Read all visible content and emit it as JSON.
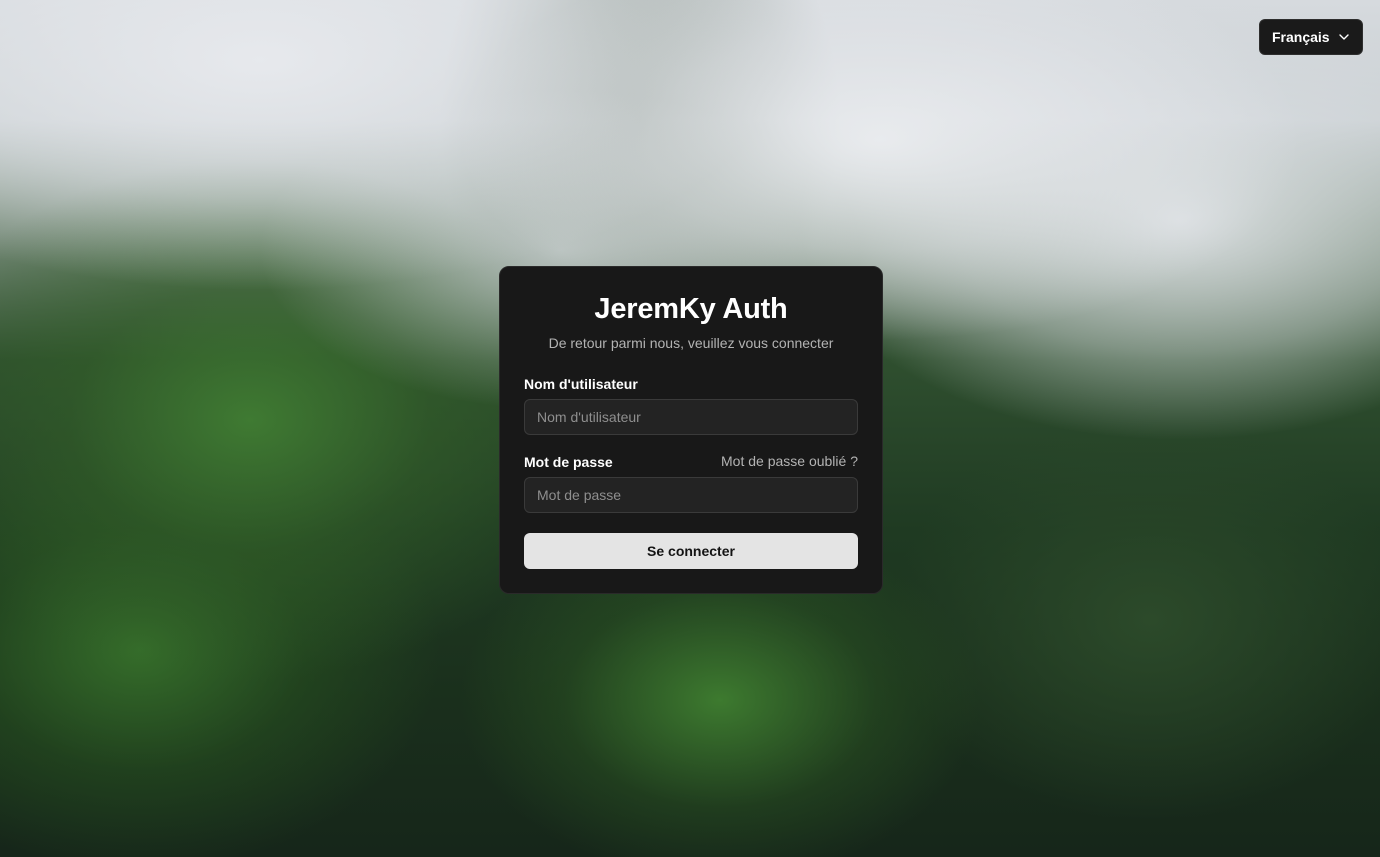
{
  "language_selector": {
    "selected": "Français",
    "icon": "chevron-down-icon"
  },
  "login_card": {
    "title": "JeremKy Auth",
    "subtitle": "De retour parmi nous, veuillez vous connecter",
    "username": {
      "label": "Nom d'utilisateur",
      "placeholder": "Nom d'utilisateur",
      "value": ""
    },
    "password": {
      "label": "Mot de passe",
      "placeholder": "Mot de passe",
      "value": "",
      "forgot_link": "Mot de passe oublié ?"
    },
    "submit_label": "Se connecter"
  },
  "colors": {
    "card_background": "#181818",
    "input_background": "#232323",
    "button_background": "#e4e4e4",
    "selector_background": "#1a1a1a"
  }
}
